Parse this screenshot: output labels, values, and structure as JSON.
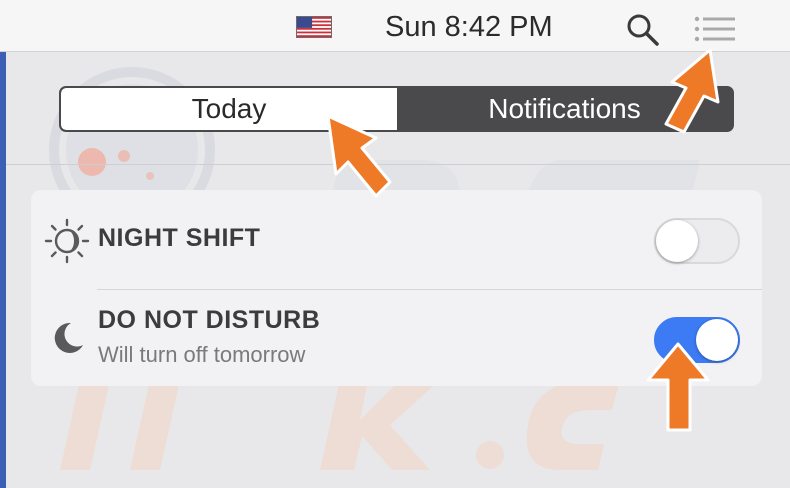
{
  "menubar": {
    "flag_icon": "us-flag-icon",
    "clock": "Sun 8:42 PM",
    "search_icon": "search-icon",
    "notification_center_icon": "list-icon"
  },
  "tabs": [
    {
      "label": "Today",
      "selected": true
    },
    {
      "label": "Notifications",
      "selected": false
    }
  ],
  "toggles": {
    "night_shift": {
      "title": "NIGHT SHIFT",
      "icon": "night-shift-icon",
      "on": false
    },
    "do_not_disturb": {
      "title": "DO NOT DISTURB",
      "subtitle": "Will turn off tomorrow",
      "icon": "moon-icon",
      "on": true
    }
  },
  "colors": {
    "accent_blue": "#3c7bf4",
    "arrow_orange": "#ee7a28",
    "segmented_dark": "#4a4a4c"
  }
}
